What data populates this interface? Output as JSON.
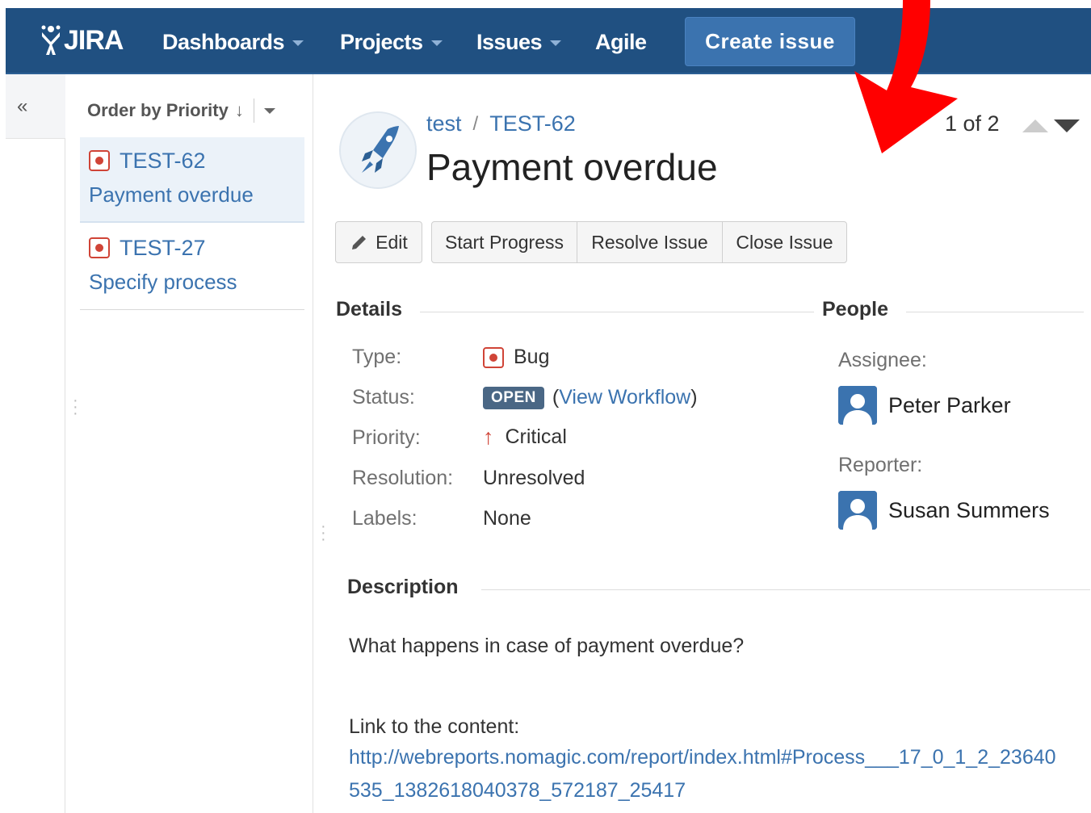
{
  "header": {
    "logo_text": "JIRA",
    "nav": [
      {
        "label": "Dashboards",
        "has_caret": true
      },
      {
        "label": "Projects",
        "has_caret": true
      },
      {
        "label": "Issues",
        "has_caret": true
      },
      {
        "label": "Agile",
        "has_caret": false
      }
    ],
    "create_label": "Create issue"
  },
  "sidebar": {
    "collapse_icon": "«"
  },
  "issue_list": {
    "order_label": "Order by Priority",
    "order_arrow": "↓",
    "items": [
      {
        "key": "TEST-62",
        "summary": "Payment overdue",
        "type_icon": "bug-icon",
        "selected": true
      },
      {
        "key": "TEST-27",
        "summary": "Specify process",
        "type_icon": "bug-icon",
        "selected": false
      }
    ]
  },
  "issue": {
    "project": "test",
    "breadcrumb_sep": "/",
    "key": "TEST-62",
    "title": "Payment overdue",
    "pager_text": "1 of 2"
  },
  "actions": {
    "edit": "Edit",
    "start_progress": "Start Progress",
    "resolve": "Resolve Issue",
    "close": "Close Issue"
  },
  "details": {
    "heading": "Details",
    "type_label": "Type:",
    "type_value": "Bug",
    "status_label": "Status:",
    "status_value": "OPEN",
    "status_color": "#4a6785",
    "workflow_open": "(",
    "workflow_link": "View Workflow",
    "workflow_close": ")",
    "priority_label": "Priority:",
    "priority_icon": "↑",
    "priority_value": "Critical",
    "resolution_label": "Resolution:",
    "resolution_value": "Unresolved",
    "labels_label": "Labels:",
    "labels_value": "None"
  },
  "people": {
    "heading": "People",
    "assignee_label": "Assignee:",
    "assignee_name": "Peter Parker",
    "reporter_label": "Reporter:",
    "reporter_name": "Susan Summers"
  },
  "description": {
    "heading": "Description",
    "text": "What happens in case of payment overdue?",
    "link_label": "Link to the content:",
    "link_url": "http://webreports.nomagic.com/report/index.html#Process___17_0_1_2_23640535_1382618040378_572187_25417"
  },
  "colors": {
    "header_bg": "#205081",
    "create_btn": "#3b73af",
    "link": "#3b73af",
    "bug": "#d04437",
    "annotation_arrow": "#ff0000"
  }
}
